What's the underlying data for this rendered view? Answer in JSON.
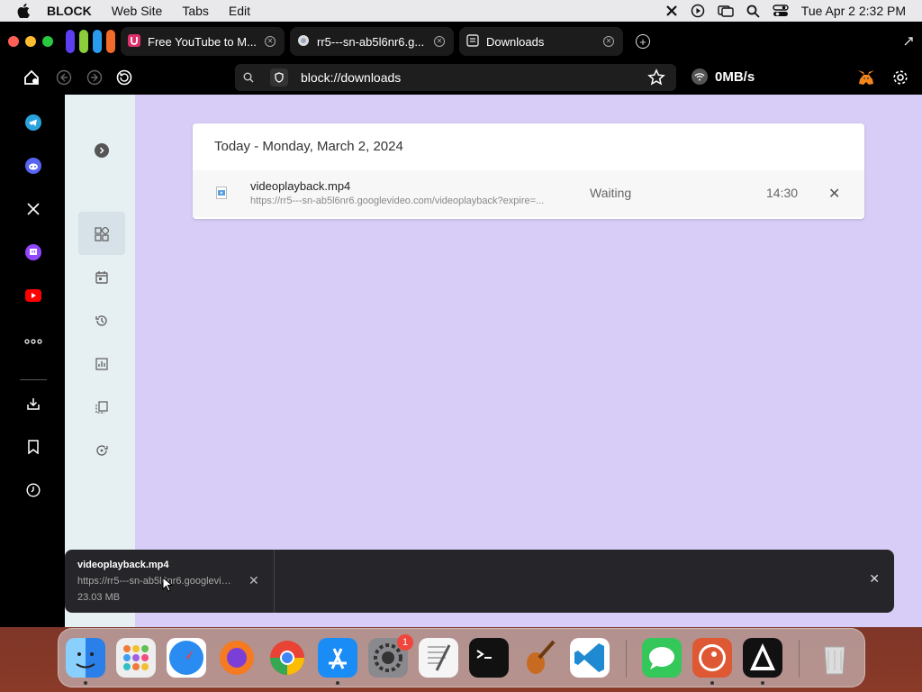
{
  "menubar": {
    "app_name": "BLOCK",
    "menus": [
      "Web Site",
      "Tabs",
      "Edit"
    ],
    "clock": "Tue Apr 2  2:32 PM"
  },
  "tabs": [
    {
      "title": "Free YouTube to M...",
      "icon": "youtube-mp3-icon",
      "active": false
    },
    {
      "title": "rr5---sn-ab5l6nr6.g...",
      "icon": "globe-icon",
      "active": false
    },
    {
      "title": "Downloads",
      "icon": "downloads-page-icon",
      "active": true
    }
  ],
  "toolbar": {
    "url": "block://downloads",
    "speed": "0MB/s"
  },
  "downloads": {
    "date_header": "Today - Monday, March 2, 2024",
    "items": [
      {
        "filename": "videoplayback.mp4",
        "url": "https://rr5---sn-ab5l6nr6.googlevideo.com/videoplayback?expire=...",
        "status": "Waiting",
        "time": "14:30",
        "remove": "✕"
      }
    ]
  },
  "shelf": {
    "filename": "videoplayback.mp4",
    "url": "https://rr5---sn-ab5l6nr6.googlevideo.com/videoplayback",
    "size": "23.03 MB",
    "remove": "✕",
    "close": "✕"
  },
  "colors": {
    "content_bg": "#d8cdf6",
    "sidebar_bg": "#e6eff2",
    "browser_chrome": "#000000"
  }
}
